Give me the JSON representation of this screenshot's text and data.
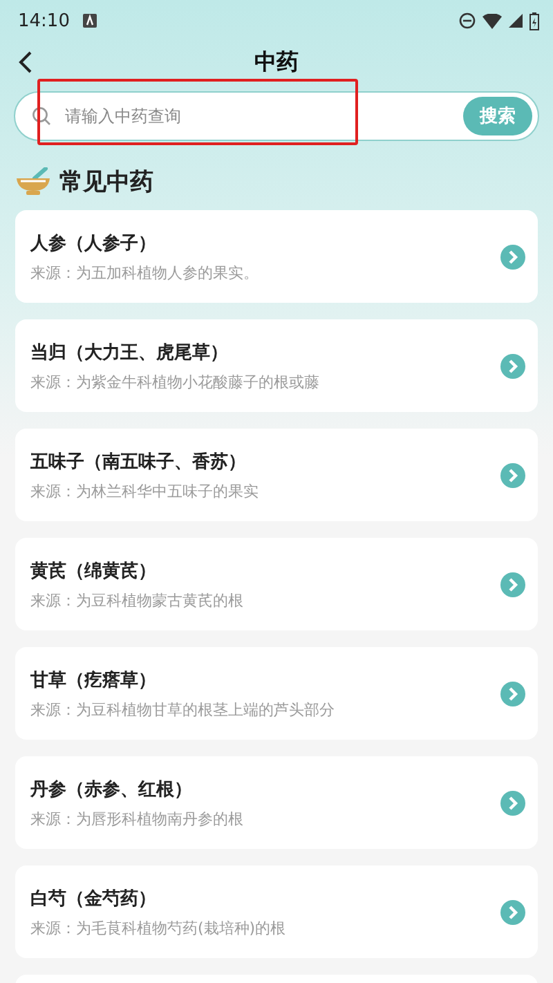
{
  "status_bar": {
    "time": "14:10"
  },
  "header": {
    "title": "中药"
  },
  "search": {
    "placeholder": "请输入中药查询",
    "button": "搜索",
    "highlighted": true
  },
  "section": {
    "title": "常见中药"
  },
  "items": [
    {
      "name": "人参（人参子）",
      "source": "来源：为五加科植物人参的果实。"
    },
    {
      "name": "当归（大力王、虎尾草）",
      "source": "来源：为紫金牛科植物小花酸藤子的根或藤"
    },
    {
      "name": "五味子（南五味子、香苏）",
      "source": "来源：为林兰科华中五味子的果实"
    },
    {
      "name": "黄芪（绵黄芪）",
      "source": "来源：为豆科植物蒙古黄芪的根"
    },
    {
      "name": "甘草（疙瘩草）",
      "source": "来源：为豆科植物甘草的根茎上端的芦头部分"
    },
    {
      "name": "丹参（赤参、红根）",
      "source": "来源：为唇形科植物南丹参的根"
    },
    {
      "name": "白芍（金芍药）",
      "source": "来源：为毛茛科植物芍药(栽培种)的根"
    }
  ]
}
